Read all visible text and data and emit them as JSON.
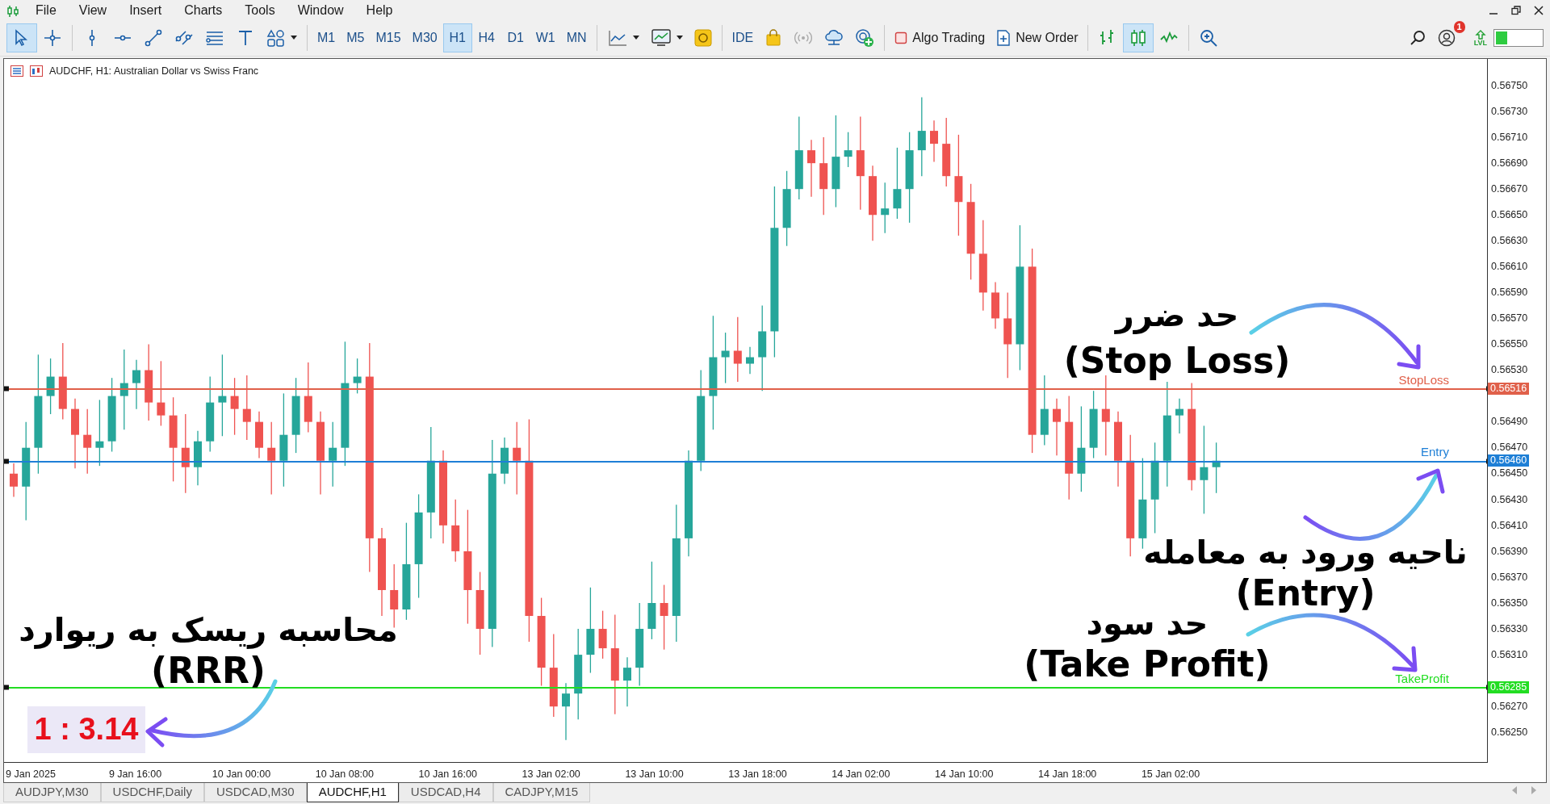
{
  "menu": [
    "File",
    "View",
    "Insert",
    "Charts",
    "Tools",
    "Window",
    "Help"
  ],
  "tools": [
    {
      "kind": "cursor",
      "selected": true
    },
    {
      "kind": "crosshair",
      "selected": false
    },
    {
      "kind": "vline",
      "selected": false
    },
    {
      "kind": "hline",
      "selected": false
    },
    {
      "kind": "trend",
      "selected": false
    },
    {
      "kind": "channel",
      "selected": false
    },
    {
      "kind": "fibo",
      "selected": false
    },
    {
      "kind": "text",
      "selected": false
    },
    {
      "kind": "shapes",
      "selected": false
    }
  ],
  "timeframes": [
    {
      "label": "M1",
      "selected": false
    },
    {
      "label": "M5",
      "selected": false
    },
    {
      "label": "M15",
      "selected": false
    },
    {
      "label": "M30",
      "selected": false
    },
    {
      "label": "H1",
      "selected": true
    },
    {
      "label": "H4",
      "selected": false
    },
    {
      "label": "D1",
      "selected": false
    },
    {
      "label": "W1",
      "selected": false
    },
    {
      "label": "MN",
      "selected": false
    }
  ],
  "ide_button": "IDE",
  "algo_trading": {
    "label": "Algo Trading",
    "on": false
  },
  "new_order": "New Order",
  "chart_types": [
    {
      "kind": "bars",
      "selected": false
    },
    {
      "kind": "candles",
      "selected": true
    },
    {
      "kind": "line",
      "selected": false
    }
  ],
  "notification_badge": "1",
  "level_icon_text": "LVL",
  "chart": {
    "title": "AUDCHF, H1:  Australian Dollar vs Swiss Franc",
    "price_ticks": [
      "0.56750",
      "0.56730",
      "0.56710",
      "0.56690",
      "0.56670",
      "0.56650",
      "0.56630",
      "0.56610",
      "0.56590",
      "0.56570",
      "0.56550",
      "0.56530",
      "0.56490",
      "0.56470",
      "0.56450",
      "0.56430",
      "0.56410",
      "0.56390",
      "0.56370",
      "0.56350",
      "0.56330",
      "0.56310",
      "0.56270",
      "0.56250"
    ],
    "time_labels": [
      "9 Jan 2025",
      "9 Jan 16:00",
      "10 Jan 00:00",
      "10 Jan 08:00",
      "10 Jan 16:00",
      "13 Jan 02:00",
      "13 Jan 10:00",
      "13 Jan 18:00",
      "14 Jan 02:00",
      "14 Jan 10:00",
      "14 Jan 18:00",
      "15 Jan 02:00"
    ],
    "levels": [
      {
        "label": "StopLoss",
        "price": "0.56516",
        "color": "#e0604a"
      },
      {
        "label": "Entry",
        "price": "0.56460",
        "color": "#1e7fd6"
      },
      {
        "label": "TakeProfit",
        "price": "0.56285",
        "color": "#22dd22"
      }
    ],
    "rrr_note": {
      "title": "محاسبه ریسک به ریوارد",
      "subtitle": "(RRR)"
    },
    "rrr": "1 : 3.14"
  },
  "annotations": [
    {
      "title": "حد ضرر",
      "subtitle": "(Stop Loss)"
    },
    {
      "title": "ناحیه ورود به معامله",
      "subtitle": "(Entry)"
    },
    {
      "title": "حد سود",
      "subtitle": "(Take Profit)"
    }
  ],
  "tabs": [
    {
      "label": "AUDJPY,M30",
      "selected": false
    },
    {
      "label": "USDCHF,Daily",
      "selected": false
    },
    {
      "label": "USDCAD,M30",
      "selected": false
    },
    {
      "label": "AUDCHF,H1",
      "selected": true
    },
    {
      "label": "USDCAD,H4",
      "selected": false
    },
    {
      "label": "CADJPY,M15",
      "selected": false
    }
  ]
}
